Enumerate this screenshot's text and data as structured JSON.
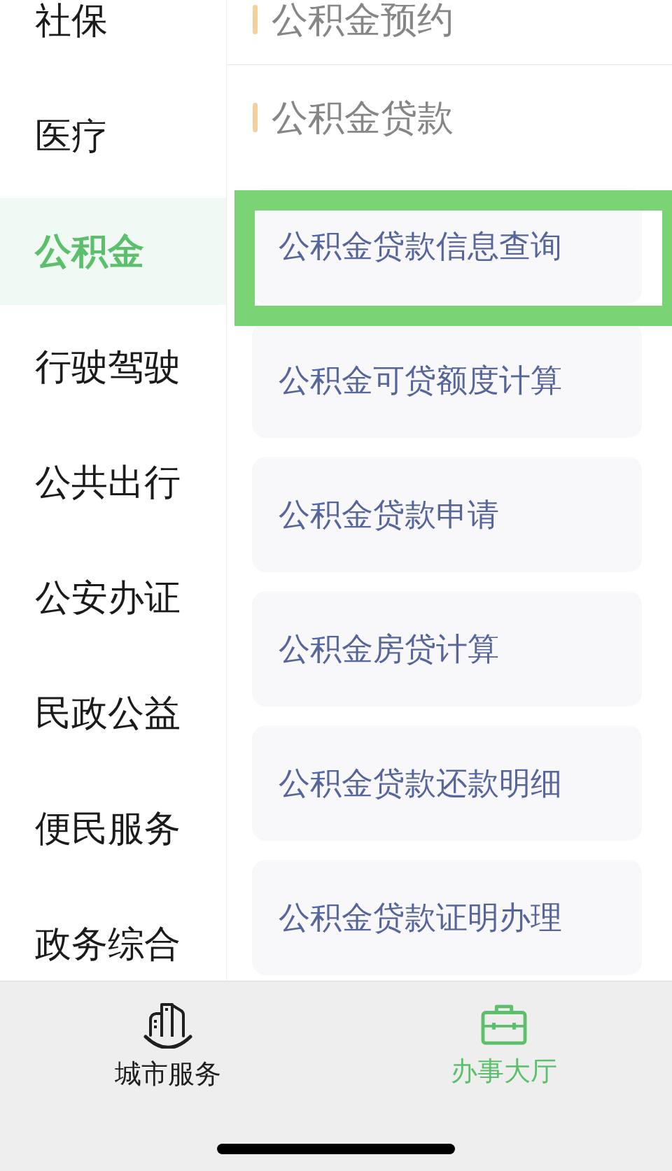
{
  "sidebar": {
    "items": [
      {
        "label": "社保",
        "selected": false
      },
      {
        "label": "医疗",
        "selected": false
      },
      {
        "label": "公积金",
        "selected": true
      },
      {
        "label": "行驶驾驶",
        "selected": false
      },
      {
        "label": "公共出行",
        "selected": false
      },
      {
        "label": "公安办证",
        "selected": false
      },
      {
        "label": "民政公益",
        "selected": false
      },
      {
        "label": "便民服务",
        "selected": false
      },
      {
        "label": "政务综合",
        "selected": false
      }
    ]
  },
  "content": {
    "sections": [
      {
        "title": "公积金预约"
      },
      {
        "title": "公积金贷款",
        "items": [
          {
            "label": "公积金贷款信息查询",
            "highlighted": true
          },
          {
            "label": "公积金可贷额度计算",
            "highlighted": false
          },
          {
            "label": "公积金贷款申请",
            "highlighted": false
          },
          {
            "label": "公积金房贷计算",
            "highlighted": false
          },
          {
            "label": "公积金贷款还款明细",
            "highlighted": false
          },
          {
            "label": "公积金贷款证明办理",
            "highlighted": false
          }
        ]
      }
    ]
  },
  "tab_bar": {
    "tabs": [
      {
        "label": "城市服务",
        "selected": false
      },
      {
        "label": "办事大厅",
        "selected": true
      }
    ]
  }
}
